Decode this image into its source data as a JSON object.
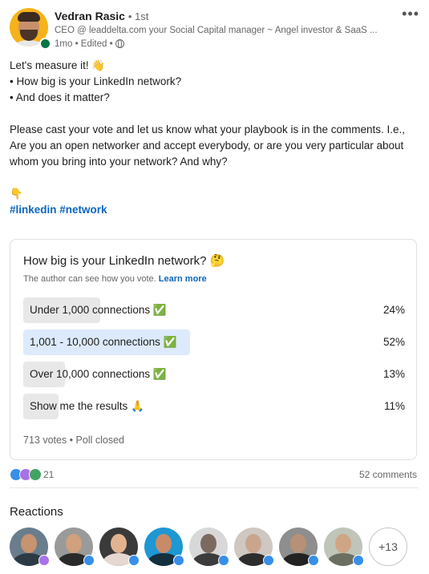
{
  "author": {
    "name": "Vedran Rasic",
    "degree": "• 1st",
    "headline": "CEO @ leaddelta.com your Social Capital manager ~ Angel investor & SaaS ...",
    "time": "1mo • Edited •"
  },
  "post": {
    "line1": "Let's measure it! 👋",
    "line2": "• How big is your LinkedIn network?",
    "line3": "• And does it matter?",
    "paragraph": "Please cast your vote and let us know what your playbook is in the comments. I.e., Are you an open networker and accept everybody, or are you very particular about whom you bring into your network? And why?",
    "pointer": "👇",
    "hashtags": [
      "#linkedin",
      "#network"
    ]
  },
  "poll": {
    "question": "How big is your LinkedIn network? 🤔",
    "note": "The author can see how you vote.",
    "learn_more": "Learn more",
    "options": [
      {
        "label": "Under 1,000 connections ✅",
        "percent": "24%",
        "value": 24
      },
      {
        "label": "1,001 - 10,000 connections ✅",
        "percent": "52%",
        "value": 52
      },
      {
        "label": "Over 10,000 connections ✅",
        "percent": "13%",
        "value": 13
      },
      {
        "label": "Show me the results 🙏",
        "percent": "11%",
        "value": 11
      }
    ],
    "footer": "713 votes • Poll closed"
  },
  "social": {
    "reaction_count": "21",
    "comments": "52 comments"
  },
  "reactions": {
    "title": "Reactions",
    "more": "+13"
  },
  "colors": {
    "link": "#0a66c2",
    "bar_default": "#e8e8e8",
    "bar_selected": "#dceafb",
    "online": "#057642"
  },
  "icons": {
    "menu": "more-options-icon",
    "visibility": "globe-icon"
  }
}
